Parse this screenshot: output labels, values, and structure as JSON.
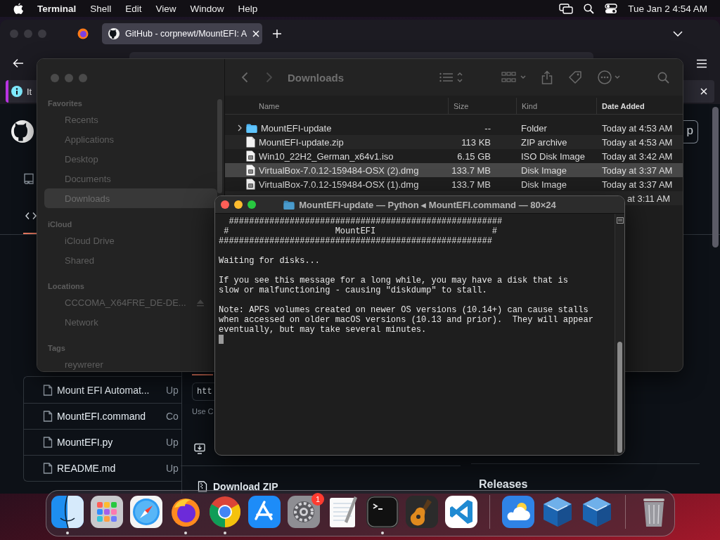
{
  "menu_bar": {
    "app_name": "Terminal",
    "menus": [
      "Shell",
      "Edit",
      "View",
      "Window",
      "Help"
    ],
    "clock": "Tue Jan 2 4:54 AM"
  },
  "browser": {
    "tabs": [
      {
        "title": "GitHub - corpnewt/MountEFI: A",
        "selected": true
      }
    ],
    "banner": {
      "text": "It"
    },
    "page": {
      "signup_button": "p",
      "files": [
        {
          "name": "Mount EFI Automat...",
          "message": "Up"
        },
        {
          "name": "MountEFI.command",
          "message": "Co"
        },
        {
          "name": "MountEFI.py",
          "message": "Up"
        },
        {
          "name": "README.md",
          "message": "Up"
        }
      ],
      "clone": {
        "url": "htt",
        "hint": "Use C",
        "download": "Download ZIP"
      },
      "releases_heading": "Releases"
    }
  },
  "finder": {
    "sidebar": [
      {
        "title": "Favorites",
        "items": [
          {
            "label": "Recents",
            "selected": false
          },
          {
            "label": "Applications",
            "selected": false
          },
          {
            "label": "Desktop",
            "selected": false
          },
          {
            "label": "Documents",
            "selected": false
          },
          {
            "label": "Downloads",
            "selected": true
          }
        ]
      },
      {
        "title": "iCloud",
        "items": [
          {
            "label": "iCloud Drive",
            "selected": false
          },
          {
            "label": "Shared",
            "selected": false
          }
        ]
      },
      {
        "title": "Locations",
        "items": [
          {
            "label": "CCCOMA_X64FRE_DE-DE...",
            "selected": false,
            "ejectable": true
          },
          {
            "label": "Network",
            "selected": false,
            "ejectable": false
          }
        ]
      },
      {
        "title": "Tags",
        "items": [
          {
            "label": "reywrerer",
            "selected": false
          }
        ]
      }
    ],
    "title": "Downloads",
    "columns": [
      {
        "label": "Name",
        "sorted": false
      },
      {
        "label": "Size",
        "sorted": false
      },
      {
        "label": "Kind",
        "sorted": false
      },
      {
        "label": "Date Added",
        "sorted": true
      }
    ],
    "rows": [
      {
        "name": "MountEFI-update",
        "size": "--",
        "file_kind": "Folder",
        "date_added": "Today at 4:53 AM",
        "kind": "folder",
        "expandable": true,
        "selected": false
      },
      {
        "name": "MountEFI-update.zip",
        "size": "113 KB",
        "file_kind": "ZIP archive",
        "date_added": "Today at 4:53 AM",
        "kind": "document",
        "expandable": false,
        "selected": false
      },
      {
        "name": "Win10_22H2_German_x64v1.iso",
        "size": "6.15 GB",
        "file_kind": "ISO Disk Image",
        "date_added": "Today at 3:42 AM",
        "kind": "disk",
        "expandable": false,
        "selected": false
      },
      {
        "name": "VirtualBox-7.0.12-159484-OSX (2).dmg",
        "size": "133.7 MB",
        "file_kind": "Disk Image",
        "date_added": "Today at 3:37 AM",
        "kind": "disk",
        "expandable": false,
        "selected": true
      },
      {
        "name": "VirtualBox-7.0.12-159484-OSX (1).dmg",
        "size": "133.7 MB",
        "file_kind": "Disk Image",
        "date_added": "Today at 3:37 AM",
        "kind": "disk",
        "expandable": false,
        "selected": false
      },
      {
        "date_added": "at 3:11 AM",
        "selected": false
      }
    ]
  },
  "terminal": {
    "title": "MountEFI-update — Python ◂ MountEFI.command — 80×24",
    "output": [
      [
        "  ######################################################",
        " #                     MountEFI                       #",
        "######################################################"
      ],
      [
        "Waiting for disks..."
      ],
      [
        "If you see this message for a long while, you may have a disk that is",
        "slow or malfunctioning - causing \"diskdump\" to stall."
      ],
      [
        "Note: APFS volumes created on newer OS versions (10.14+) can cause stalls",
        "when accessed on older macOS versions (10.13 and prior).  They will appear",
        "eventually, but may take several minutes."
      ]
    ]
  },
  "dock": {
    "sections": [
      [
        {
          "kind": "finder",
          "running": true
        },
        {
          "kind": "launchpad",
          "running": false
        },
        {
          "kind": "safari",
          "running": false
        },
        {
          "kind": "firefox",
          "running": true
        },
        {
          "kind": "chrome",
          "running": true
        },
        {
          "kind": "appstore",
          "running": false
        },
        {
          "kind": "settings",
          "running": false,
          "badge": "1"
        },
        {
          "kind": "textedit",
          "running": false
        },
        {
          "kind": "terminal",
          "running": true
        },
        {
          "kind": "garageband",
          "running": false
        },
        {
          "kind": "vscode",
          "running": false
        }
      ],
      [
        {
          "kind": "weather",
          "running": false
        },
        {
          "kind": "virtualbox",
          "running": false
        },
        {
          "kind": "virtualbox",
          "running": false
        }
      ],
      [
        {
          "kind": "trash",
          "running": false
        }
      ]
    ]
  }
}
